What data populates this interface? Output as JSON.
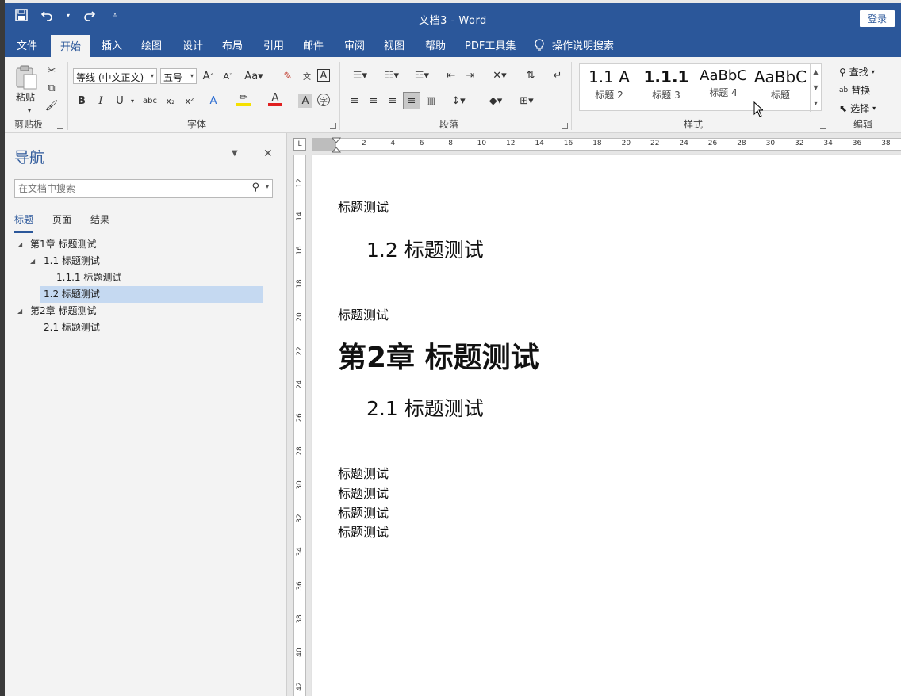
{
  "titlebar": {
    "title": "文档3  -  Word",
    "login": "登录",
    "qat_icons": [
      "save-icon",
      "undo-icon",
      "redo-icon",
      "customize-qat-icon"
    ]
  },
  "tabs": [
    "文件",
    "开始",
    "插入",
    "绘图",
    "设计",
    "布局",
    "引用",
    "邮件",
    "审阅",
    "视图",
    "帮助",
    "PDF工具集"
  ],
  "active_tab": "开始",
  "tell_me": "操作说明搜索",
  "ribbon": {
    "clipboard": {
      "paste": "粘贴",
      "group": "剪贴板"
    },
    "font": {
      "font_name": "等线 (中文正文)",
      "font_size": "五号",
      "group": "字体"
    },
    "paragraph": {
      "group": "段落"
    },
    "styles": {
      "group": "样式",
      "items": [
        {
          "sample": "1.1  A",
          "name": "标题 2"
        },
        {
          "sample": "1.1.1",
          "name": "标题 3"
        },
        {
          "sample": "AaBbC",
          "name": "标题 4"
        },
        {
          "sample": "AaBbC",
          "name": "标题"
        }
      ]
    },
    "editing": {
      "find": "查找",
      "replace": "替换",
      "select": "选择",
      "group": "编辑"
    }
  },
  "nav": {
    "title": "导航",
    "search_placeholder": "在文档中搜索",
    "tabs": [
      "标题",
      "页面",
      "结果"
    ],
    "outline": [
      {
        "label": "第1章 标题测试",
        "level": 1,
        "expanded": true,
        "selected": false
      },
      {
        "label": "1.1 标题测试",
        "level": 2,
        "expanded": true,
        "selected": false
      },
      {
        "label": "1.1.1 标题测试",
        "level": 3,
        "expanded": false,
        "selected": false
      },
      {
        "label": "1.2 标题测试",
        "level": 2,
        "expanded": false,
        "selected": true
      },
      {
        "label": "第2章 标题测试",
        "level": 1,
        "expanded": true,
        "selected": false
      },
      {
        "label": "2.1 标题测试",
        "level": 2,
        "expanded": false,
        "selected": false
      }
    ]
  },
  "rulers": {
    "horizontal": [
      "2",
      "4",
      "6",
      "8",
      "10",
      "12",
      "14",
      "16",
      "18",
      "20",
      "22",
      "24",
      "26",
      "28",
      "30",
      "32",
      "34",
      "36",
      "38"
    ],
    "vertical": [
      "12",
      "14",
      "16",
      "18",
      "20",
      "22",
      "24",
      "26",
      "28",
      "30",
      "32",
      "34",
      "36",
      "38",
      "40",
      "42"
    ]
  },
  "document": {
    "paragraphs": [
      {
        "text": "标题测试",
        "style": "body"
      },
      {
        "text": "1.2  标题测试",
        "style": "h2"
      },
      {
        "text": "标题测试",
        "style": "body"
      },
      {
        "text": "第2章 标题测试",
        "style": "h1"
      },
      {
        "text": "2.1  标题测试",
        "style": "h2"
      },
      {
        "text": "标题测试",
        "style": "body"
      },
      {
        "text": "标题测试",
        "style": "body"
      },
      {
        "text": "标题测试",
        "style": "body"
      },
      {
        "text": "标题测试",
        "style": "body"
      }
    ]
  },
  "colors": {
    "accent": "#2b579a",
    "selection": "#c5d9f1"
  }
}
